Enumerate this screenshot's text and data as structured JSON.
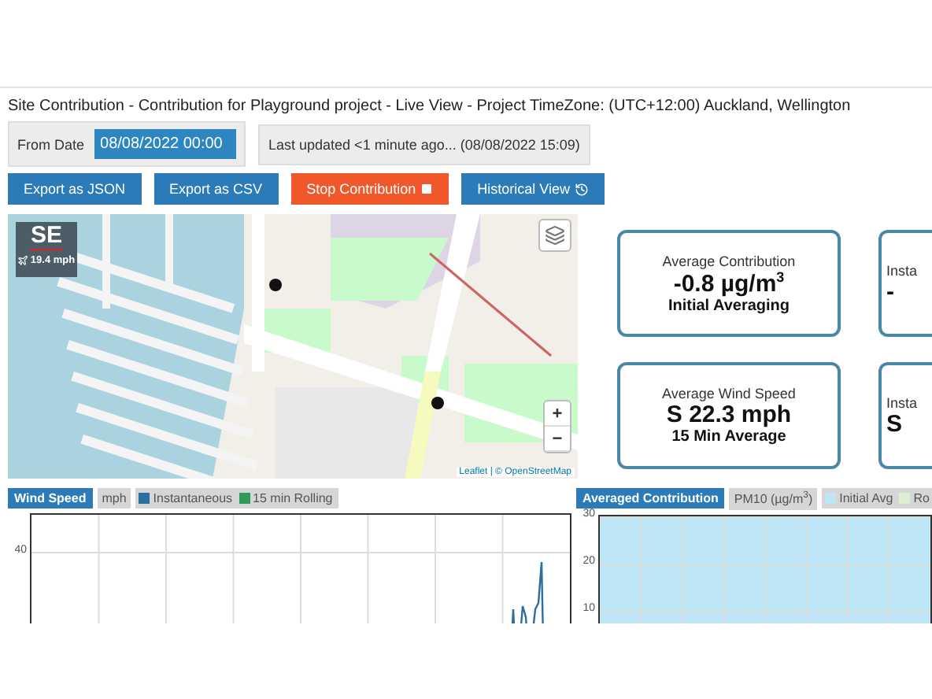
{
  "title": "Site Contribution - Contribution for Playground project - Live View - Project TimeZone: (UTC+12:00) Auckland, Wellington",
  "from_date": {
    "label": "From Date",
    "value": "08/08/2022 00:00"
  },
  "last_updated": "Last updated <1 minute ago... (08/08/2022 15:09)",
  "buttons": [
    {
      "label": "Export as JSON",
      "kind": "plain"
    },
    {
      "label": "Export as CSV",
      "kind": "plain"
    },
    {
      "label": "Stop Contribution",
      "kind": "stop"
    },
    {
      "label": "Historical View",
      "kind": "history"
    }
  ],
  "map": {
    "wind_direction": "SE",
    "wind_speed": "19.4 mph",
    "zoom_in": "+",
    "zoom_out": "−",
    "attribution": "Leaflet | © OpenStreetMap"
  },
  "cards": [
    {
      "label": "Average Contribution",
      "value": "-0.8 µg/m$^{3}$",
      "note": "Initial Averaging"
    },
    {
      "label": "Insta",
      "value": "-"
    },
    {
      "label": "Average Wind Speed",
      "value": "S 22.3 mph",
      "note": "15 Min Average"
    },
    {
      "label": "Insta",
      "value": "S"
    }
  ],
  "charts": [
    {
      "tab": "Wind Speed",
      "unit": "mph",
      "legend": [
        {
          "label": "Instantaneous",
          "color": "#2b6fa0"
        },
        {
          "label": "15 min Rolling",
          "color": "#2e9b5a"
        }
      ],
      "y_ticks": [
        "40"
      ],
      "kind": "line"
    },
    {
      "tab": "Averaged Contribution",
      "unit": "PM10 (µg/m$^{3}$)",
      "legend": [
        {
          "label": "Initial Avg",
          "color": "#bfe6f7"
        },
        {
          "label": "Ro",
          "color": "#dcefd2"
        }
      ],
      "y_ticks": [
        "30",
        "20",
        "10"
      ],
      "kind": "area"
    }
  ]
}
